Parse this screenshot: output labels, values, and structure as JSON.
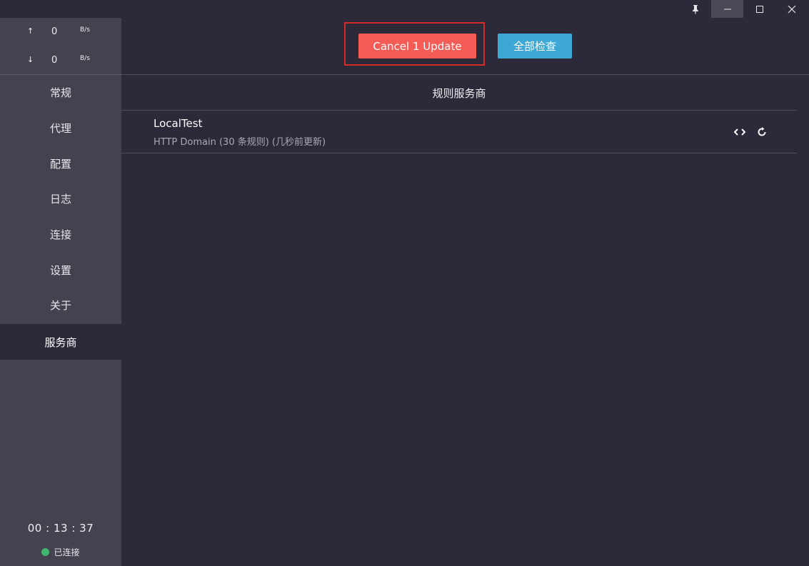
{
  "window": {
    "controls": [
      "pin-icon",
      "minimize-icon",
      "maximize-icon",
      "close-icon"
    ]
  },
  "sidebar": {
    "upload": {
      "arrow": "↑",
      "value": "0",
      "unit": "B/s"
    },
    "download": {
      "arrow": "↓",
      "value": "0",
      "unit": "B/s"
    },
    "nav_items": [
      "常规",
      "代理",
      "配置",
      "日志",
      "连接",
      "设置",
      "关于"
    ],
    "active_item": "服务商",
    "timer": "00 : 13 : 37",
    "status_label": "已连接",
    "status_color": "#3fb56d"
  },
  "main": {
    "cancel_label": "Cancel 1 Update",
    "check_all_label": "全部检查",
    "section_title": "规则服务商",
    "providers": [
      {
        "name": "LocalTest",
        "description": "HTTP Domain (30 条规则) (几秒前更新)",
        "actions": [
          "code-icon",
          "refresh-icon"
        ]
      }
    ]
  },
  "colors": {
    "background": "#2c2a38",
    "sidebar": "#43424f",
    "cancel_button": "#f55c56",
    "check_button": "#3da7d6",
    "highlight_border": "#d62b2b"
  }
}
